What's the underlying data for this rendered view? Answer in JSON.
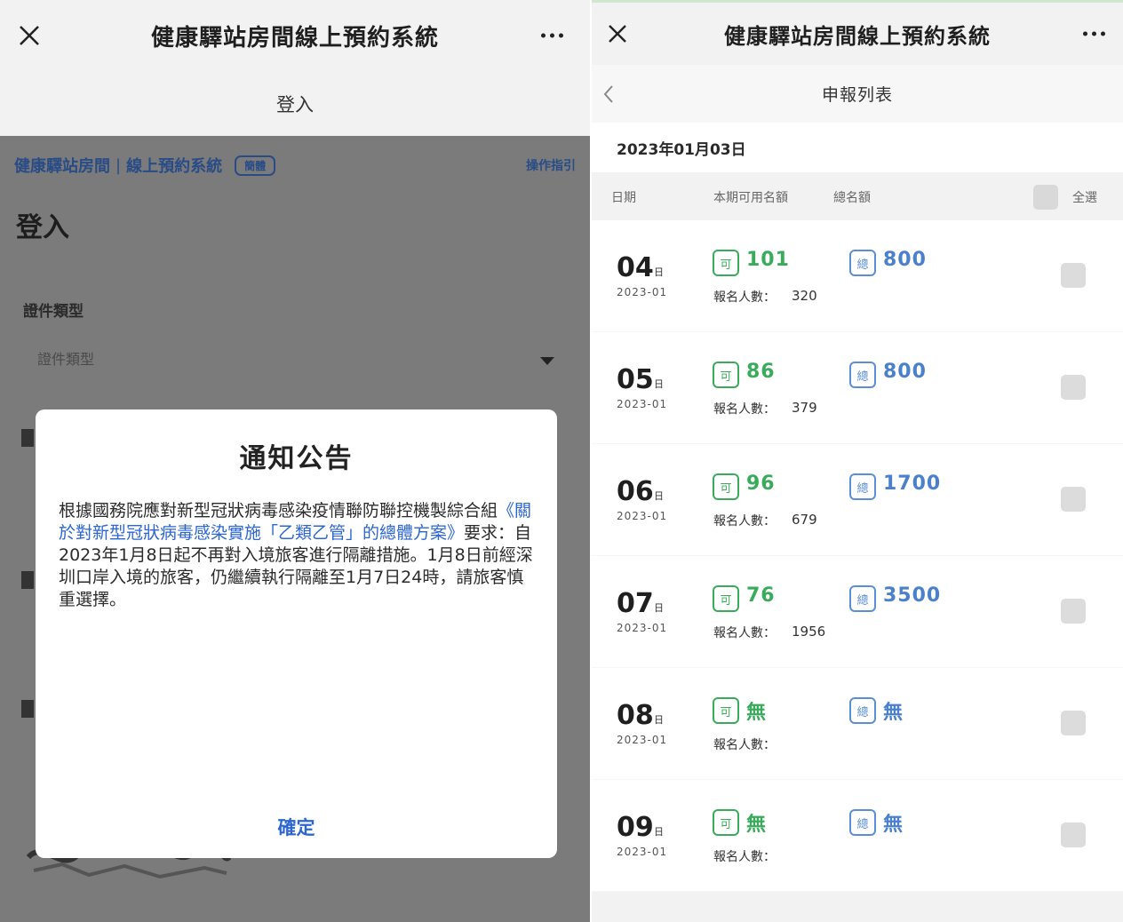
{
  "left": {
    "app_title": "健康驛站房間線上預約系統",
    "page_label": "登入",
    "site": {
      "brand": "健康驛站房間",
      "separator": "|",
      "subtitle": "線上預約系統",
      "badge": "簡體",
      "guide": "操作指引"
    },
    "login_heading": "登入",
    "id_type_label": "證件類型",
    "id_type_placeholder": "證件類型",
    "notice": {
      "title": "通知公告",
      "text_1": "根據國務院應對新型冠狀病毒感染疫情聯防聯控機製綜合組",
      "link": "《關於對新型冠狀病毒感染實施「乙類乙管」的總體方案》",
      "text_2": "要求：自2023年1月8日起不再對入境旅客進行隔離措施。1月8日前經深圳口岸入境的旅客，仍繼續執行隔離至1月7日24時，請旅客慎重選擇。",
      "confirm": "確定"
    }
  },
  "right": {
    "app_title": "健康驛站房間線上預約系統",
    "nav_title": "申報列表",
    "date": "2023年01月03日",
    "columns": {
      "date": "日期",
      "available": "本期可用名額",
      "total": "總名額",
      "select_all": "全選"
    },
    "tag_available": "可",
    "tag_total": "總",
    "reg_label": "報名人數：",
    "day_unit": "日",
    "rows": [
      {
        "day": "04",
        "ym": "2023-01",
        "available": "101",
        "total": "800",
        "registered": "320"
      },
      {
        "day": "05",
        "ym": "2023-01",
        "available": "86",
        "total": "800",
        "registered": "379"
      },
      {
        "day": "06",
        "ym": "2023-01",
        "available": "96",
        "total": "1700",
        "registered": "679"
      },
      {
        "day": "07",
        "ym": "2023-01",
        "available": "76",
        "total": "3500",
        "registered": "1956"
      },
      {
        "day": "08",
        "ym": "2023-01",
        "available": "無",
        "total": "無",
        "registered": ""
      },
      {
        "day": "09",
        "ym": "2023-01",
        "available": "無",
        "total": "無",
        "registered": ""
      }
    ]
  },
  "colors": {
    "available_green": "#3aab5b",
    "total_blue": "#4a80cc",
    "link_blue": "#2c66d2",
    "overlay_gray": "#7b7b7b"
  }
}
